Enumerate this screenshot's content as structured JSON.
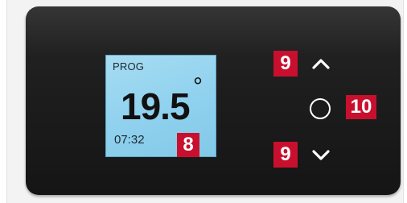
{
  "display": {
    "mode": "PROG",
    "temperature": "19.5",
    "degree_symbol": "°",
    "time": "07:32"
  },
  "callouts": {
    "display_number": "8",
    "up_number": "9",
    "down_number": "9",
    "ok_number": "10"
  },
  "controls": {
    "up_icon": "chevron-up-icon",
    "ok_icon": "circle-button-icon",
    "down_icon": "chevron-down-icon"
  },
  "colors": {
    "device_body": "#1d1d1d",
    "lcd_background": "#8fd1ee",
    "callout_red": "#c8102e",
    "control_white": "#ffffff"
  }
}
